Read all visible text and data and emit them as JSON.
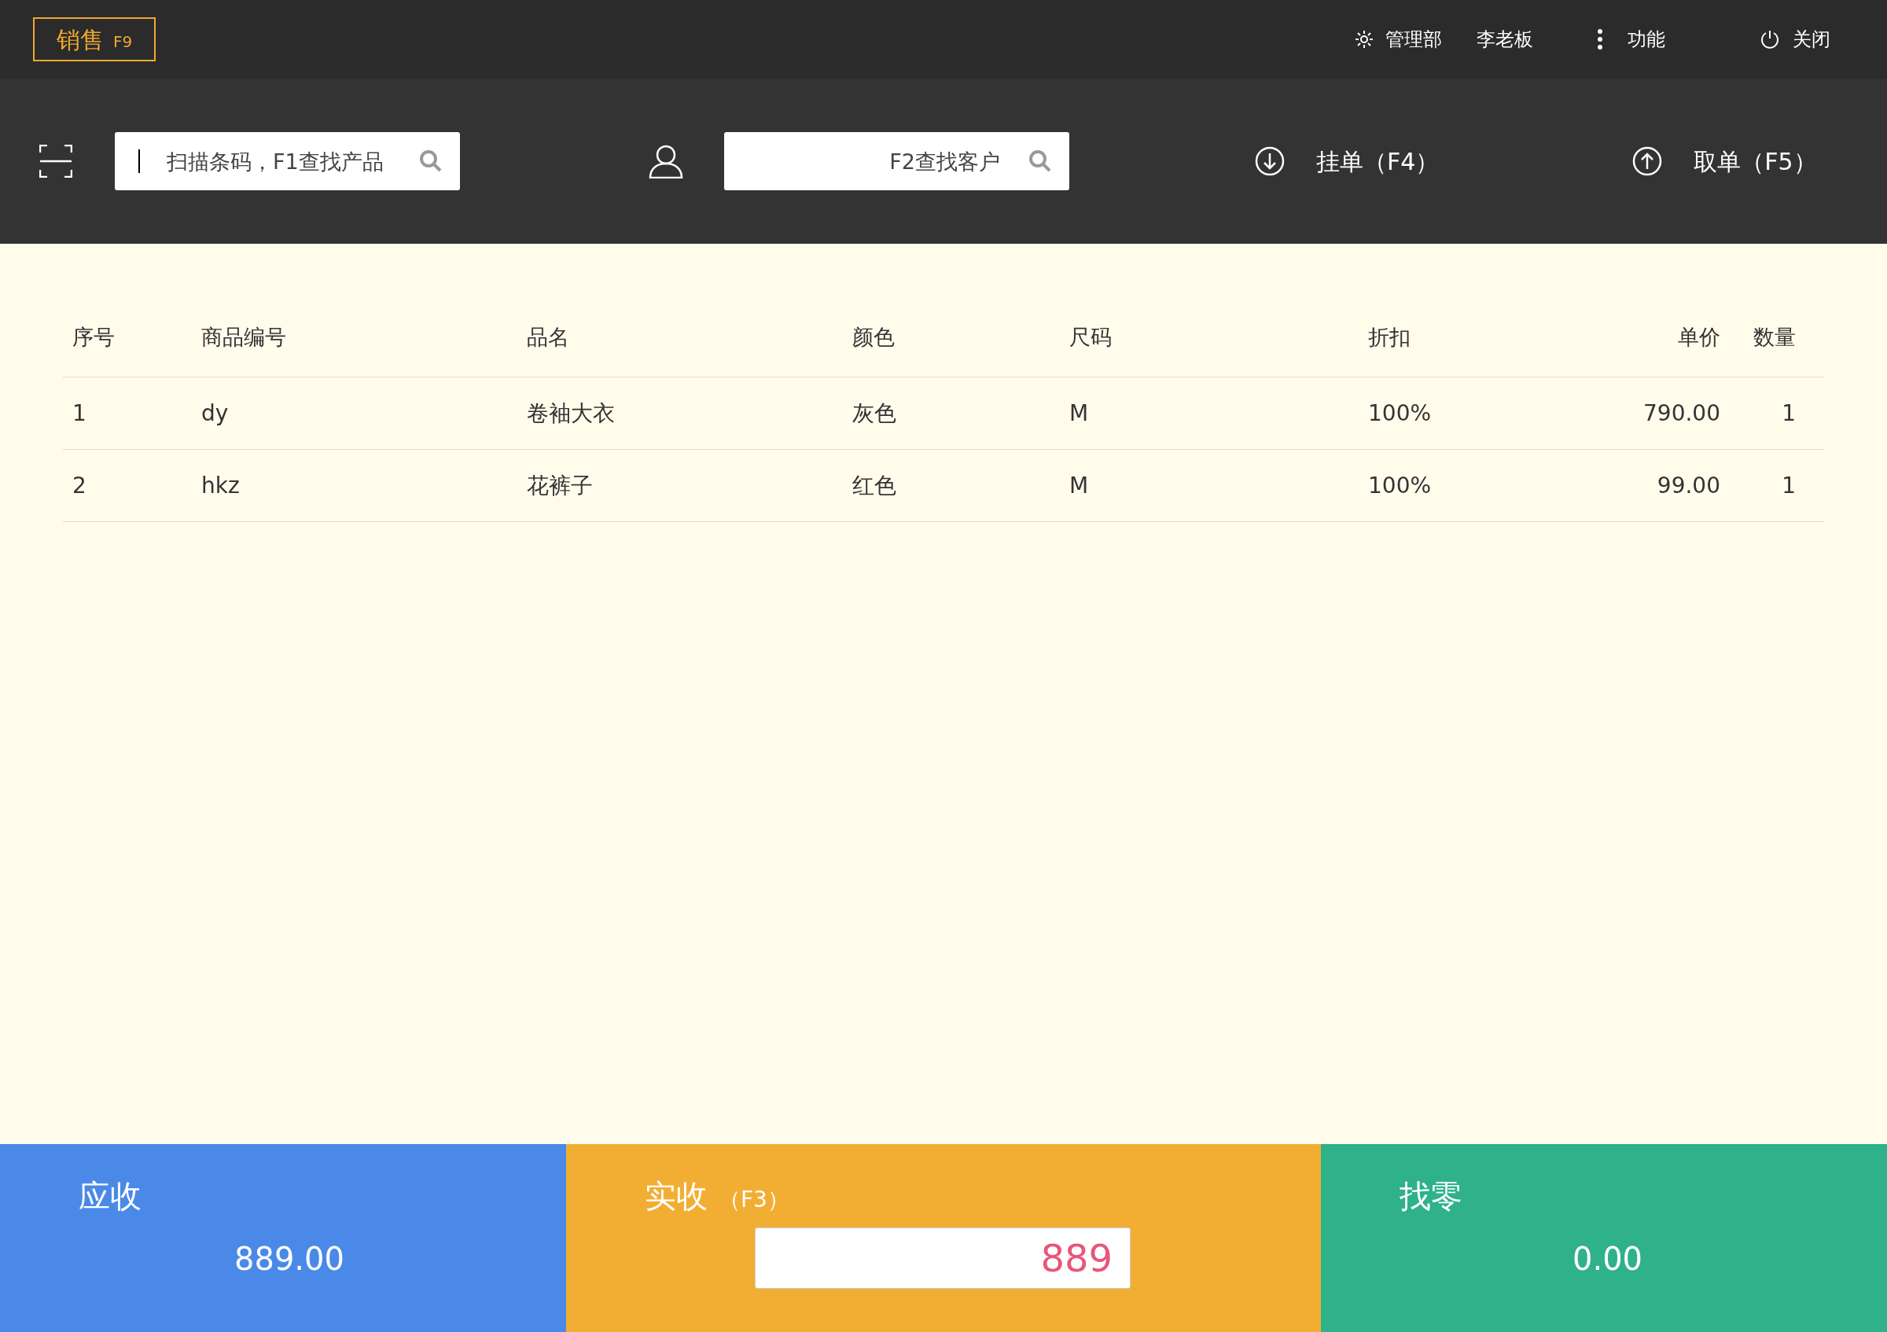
{
  "app_tab": {
    "label": "销售",
    "shortcut": "F9",
    "selected": true
  },
  "header_menu": [
    {
      "kind": "settings",
      "label": "管理部"
    },
    {
      "kind": "plain",
      "label": "李老板"
    },
    {
      "kind": "more",
      "label": "功能"
    },
    {
      "kind": "power",
      "label": "关闭"
    }
  ],
  "toolbar": {
    "product_search": {
      "placeholder": "扫描条码，F1查找产品"
    },
    "customer_search": {
      "placeholder": "F2查找客户"
    },
    "actions": [
      {
        "kind": "hold",
        "label": "挂单（F4）"
      },
      {
        "kind": "retrieve",
        "label": "取单（F5）"
      }
    ]
  },
  "table": {
    "columns": [
      "序号",
      "商品编号",
      "品名",
      "颜色",
      "尺码",
      "折扣",
      "单价",
      "数量"
    ],
    "rows": [
      [
        "1",
        "dy",
        "卷袖大衣",
        "灰色",
        "M",
        "100%",
        "790.00",
        "1"
      ],
      [
        "2",
        "hkz",
        "花裤子",
        "红色",
        "M",
        "100%",
        "99.00",
        "1"
      ]
    ]
  },
  "totals": [
    {
      "kind": "due",
      "label": "应收",
      "value": "889.00"
    },
    {
      "kind": "received",
      "label": "实收",
      "shortcut": "（F3）",
      "value": "889"
    },
    {
      "kind": "change",
      "label": "找零",
      "value": "0.00"
    }
  ]
}
